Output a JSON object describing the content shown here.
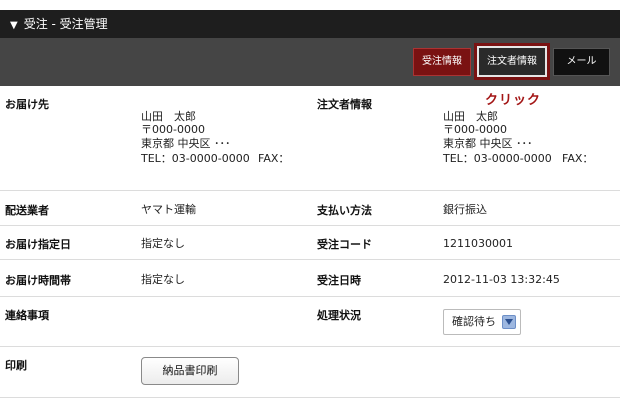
{
  "title": "受注 - 受注管理",
  "tabs": [
    {
      "label": "受注情報"
    },
    {
      "label": "注文者情報"
    },
    {
      "label": "メール"
    }
  ],
  "annotation": "クリック",
  "delivery": {
    "label": "お届け先",
    "name": "山田　太郎",
    "postal": "〒000-0000",
    "address": "東京都 中央区 ･･･",
    "tel": "TEL：03-0000-0000",
    "fax": "FAX："
  },
  "orderer": {
    "label": "注文者情報",
    "name": "山田　太郎",
    "postal": "〒000-0000",
    "address": "東京都 中央区 ･･･",
    "tel": "TEL：03-0000-0000",
    "fax": "FAX："
  },
  "rows": {
    "carrier": {
      "label": "配送業者",
      "value": "ヤマト運輸"
    },
    "payment": {
      "label": "支払い方法",
      "value": "銀行振込"
    },
    "delivery_date": {
      "label": "お届け指定日",
      "value": "指定なし"
    },
    "order_code": {
      "label": "受注コード",
      "value": "1211030001"
    },
    "delivery_time": {
      "label": "お届け時間帯",
      "value": "指定なし"
    },
    "order_datetime": {
      "label": "受注日時",
      "value": "2012-11-03 13:32:45"
    },
    "notes": {
      "label": "連絡事項",
      "value": ""
    },
    "status": {
      "label": "処理状況",
      "value": "確認待ち"
    },
    "print": {
      "label": "印刷",
      "button": "納品書印刷"
    }
  }
}
